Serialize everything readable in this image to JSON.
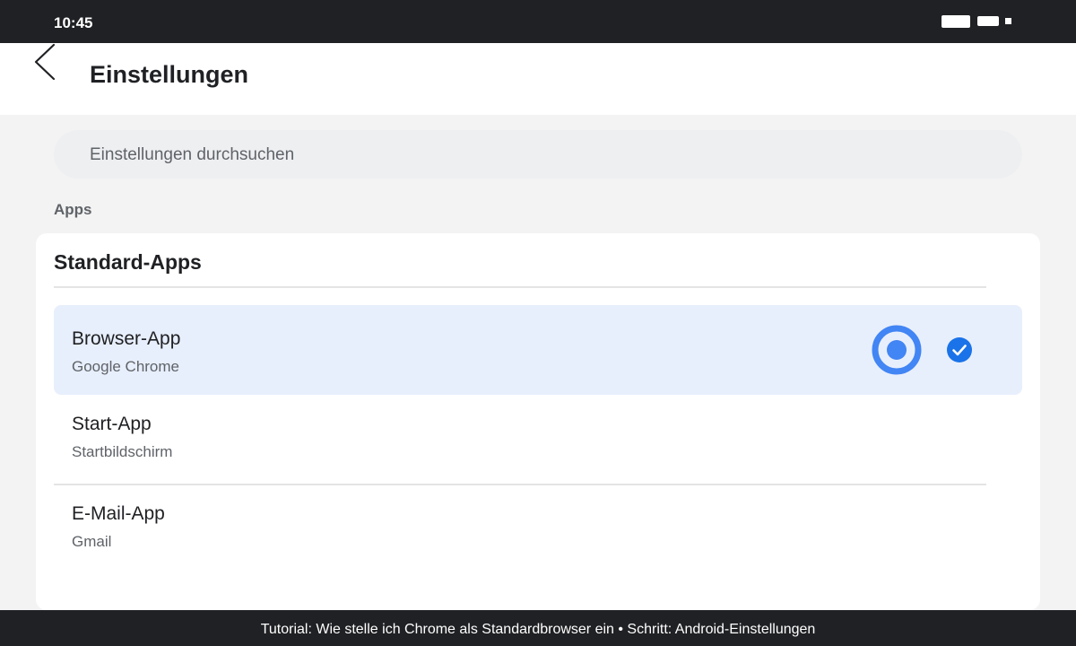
{
  "status_bar": {
    "time": "10:45",
    "icons": [
      "battery-icon",
      "wifi-icon",
      "signal-icon"
    ]
  },
  "app_bar": {
    "back_icon": "chevron-left-icon",
    "title": "Einstellungen"
  },
  "search": {
    "placeholder": "Einstellungen durchsuchen"
  },
  "section": {
    "label": "Apps"
  },
  "card": {
    "title": "Standard-Apps",
    "items": [
      {
        "title": "Browser-App",
        "subtitle": "Google Chrome",
        "selected": true
      },
      {
        "title": "Start-App",
        "subtitle": "Startbildschirm",
        "selected": false
      },
      {
        "title": "E-Mail-App",
        "subtitle": "Gmail",
        "selected": false
      }
    ]
  },
  "footer": {
    "caption": "Tutorial: Wie stelle ich Chrome als Standardbrowser ein • Schritt: Android-Einstellungen"
  },
  "colors": {
    "accent": "#4285f4",
    "check": "#1a73e8",
    "selected_background": "#e8effc",
    "dark_bar": "#202124"
  }
}
